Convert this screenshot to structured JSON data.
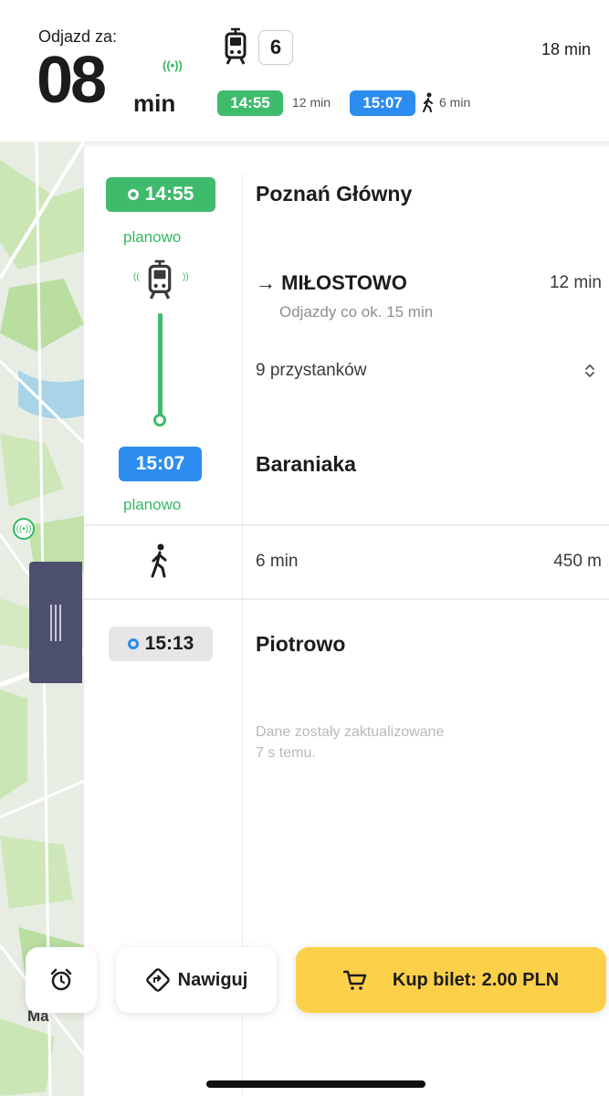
{
  "header": {
    "departure_label": "Odjazd za:",
    "countdown_value": "08",
    "countdown_unit": "min",
    "live_indicator": "((•))",
    "line_number": "6",
    "total_duration": "18 min",
    "segments": [
      {
        "time": "14:55",
        "duration": "12 min"
      },
      {
        "time": "15:07",
        "duration": "6 min"
      }
    ]
  },
  "timeline": {
    "departure": {
      "time": "14:55",
      "status": "planowo",
      "stop": "Poznań Główny"
    },
    "ride": {
      "direction": "→ MIŁOSTOWO",
      "duration": "12 min",
      "frequency": "Odjazdy co ok. 15 min",
      "stops_count": "9 przystanków"
    },
    "arrival": {
      "time": "15:07",
      "status": "planowo",
      "stop": "Baraniaka"
    },
    "walk": {
      "duration": "6 min",
      "distance": "450 m"
    },
    "destination": {
      "time": "15:13",
      "stop": "Piotrowo"
    },
    "update_note_line1": "Dane zostały zaktualizowane",
    "update_note_line2": "7 s temu."
  },
  "map": {
    "brand_label": "Ma"
  },
  "actions": {
    "alarm_icon": "alarm-clock-icon",
    "navigate_label": "Nawiguj",
    "buy_label": "Kup bilet: 2.00 PLN"
  },
  "colors": {
    "green": "#3fbb6c",
    "blue": "#2d8cf0",
    "buy_button": "#fdd049",
    "map_handle": "#4d4f6e"
  }
}
